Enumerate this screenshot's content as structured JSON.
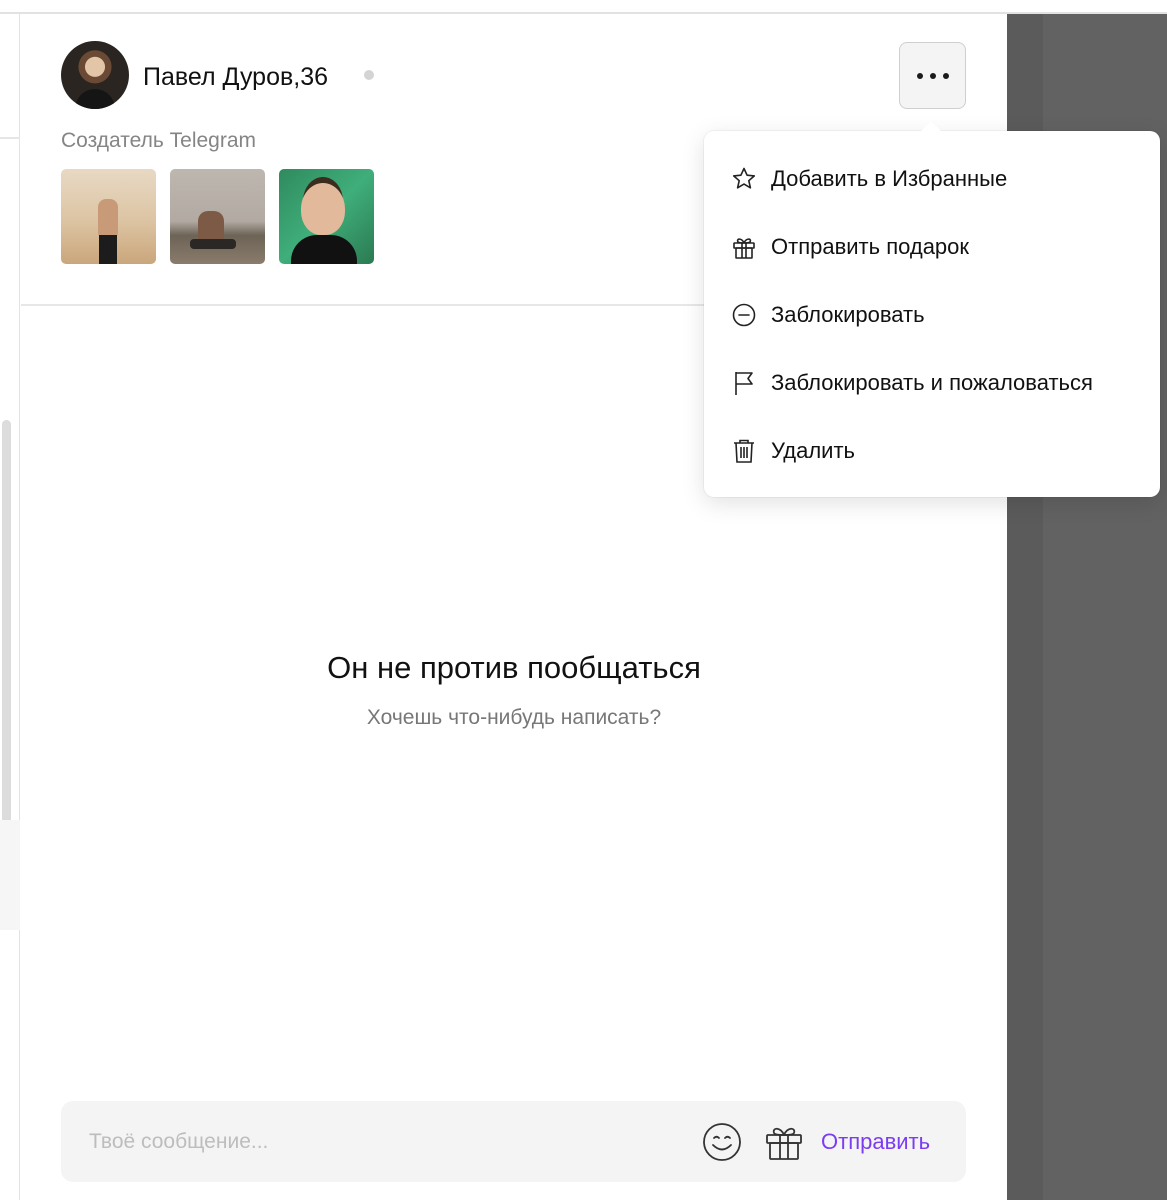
{
  "profile": {
    "name_age": "Павел Дуров,36",
    "bio": "Создатель Telegram",
    "photos": [
      "photo-desert",
      "photo-seaside",
      "photo-portrait"
    ]
  },
  "empty_state": {
    "title": "Он не против пообщаться",
    "subtitle": "Хочешь что-нибудь написать?"
  },
  "menu": {
    "items": [
      {
        "label": "Добавить в Избранные",
        "icon": "star-icon"
      },
      {
        "label": "Отправить подарок",
        "icon": "gift-icon"
      },
      {
        "label": "Заблокировать",
        "icon": "block-icon"
      },
      {
        "label": "Заблокировать и пожаловаться",
        "icon": "flag-icon"
      },
      {
        "label": "Удалить",
        "icon": "trash-icon"
      }
    ]
  },
  "composer": {
    "placeholder": "Твоё сообщение...",
    "send_label": "Отправить",
    "emoji_icon": "smile-icon",
    "gift_icon": "gift-icon"
  },
  "colors": {
    "accent": "#7b3cf2",
    "muted_text": "#858585",
    "composer_bg": "#f4f4f4",
    "overlay_dark": "#626262"
  }
}
